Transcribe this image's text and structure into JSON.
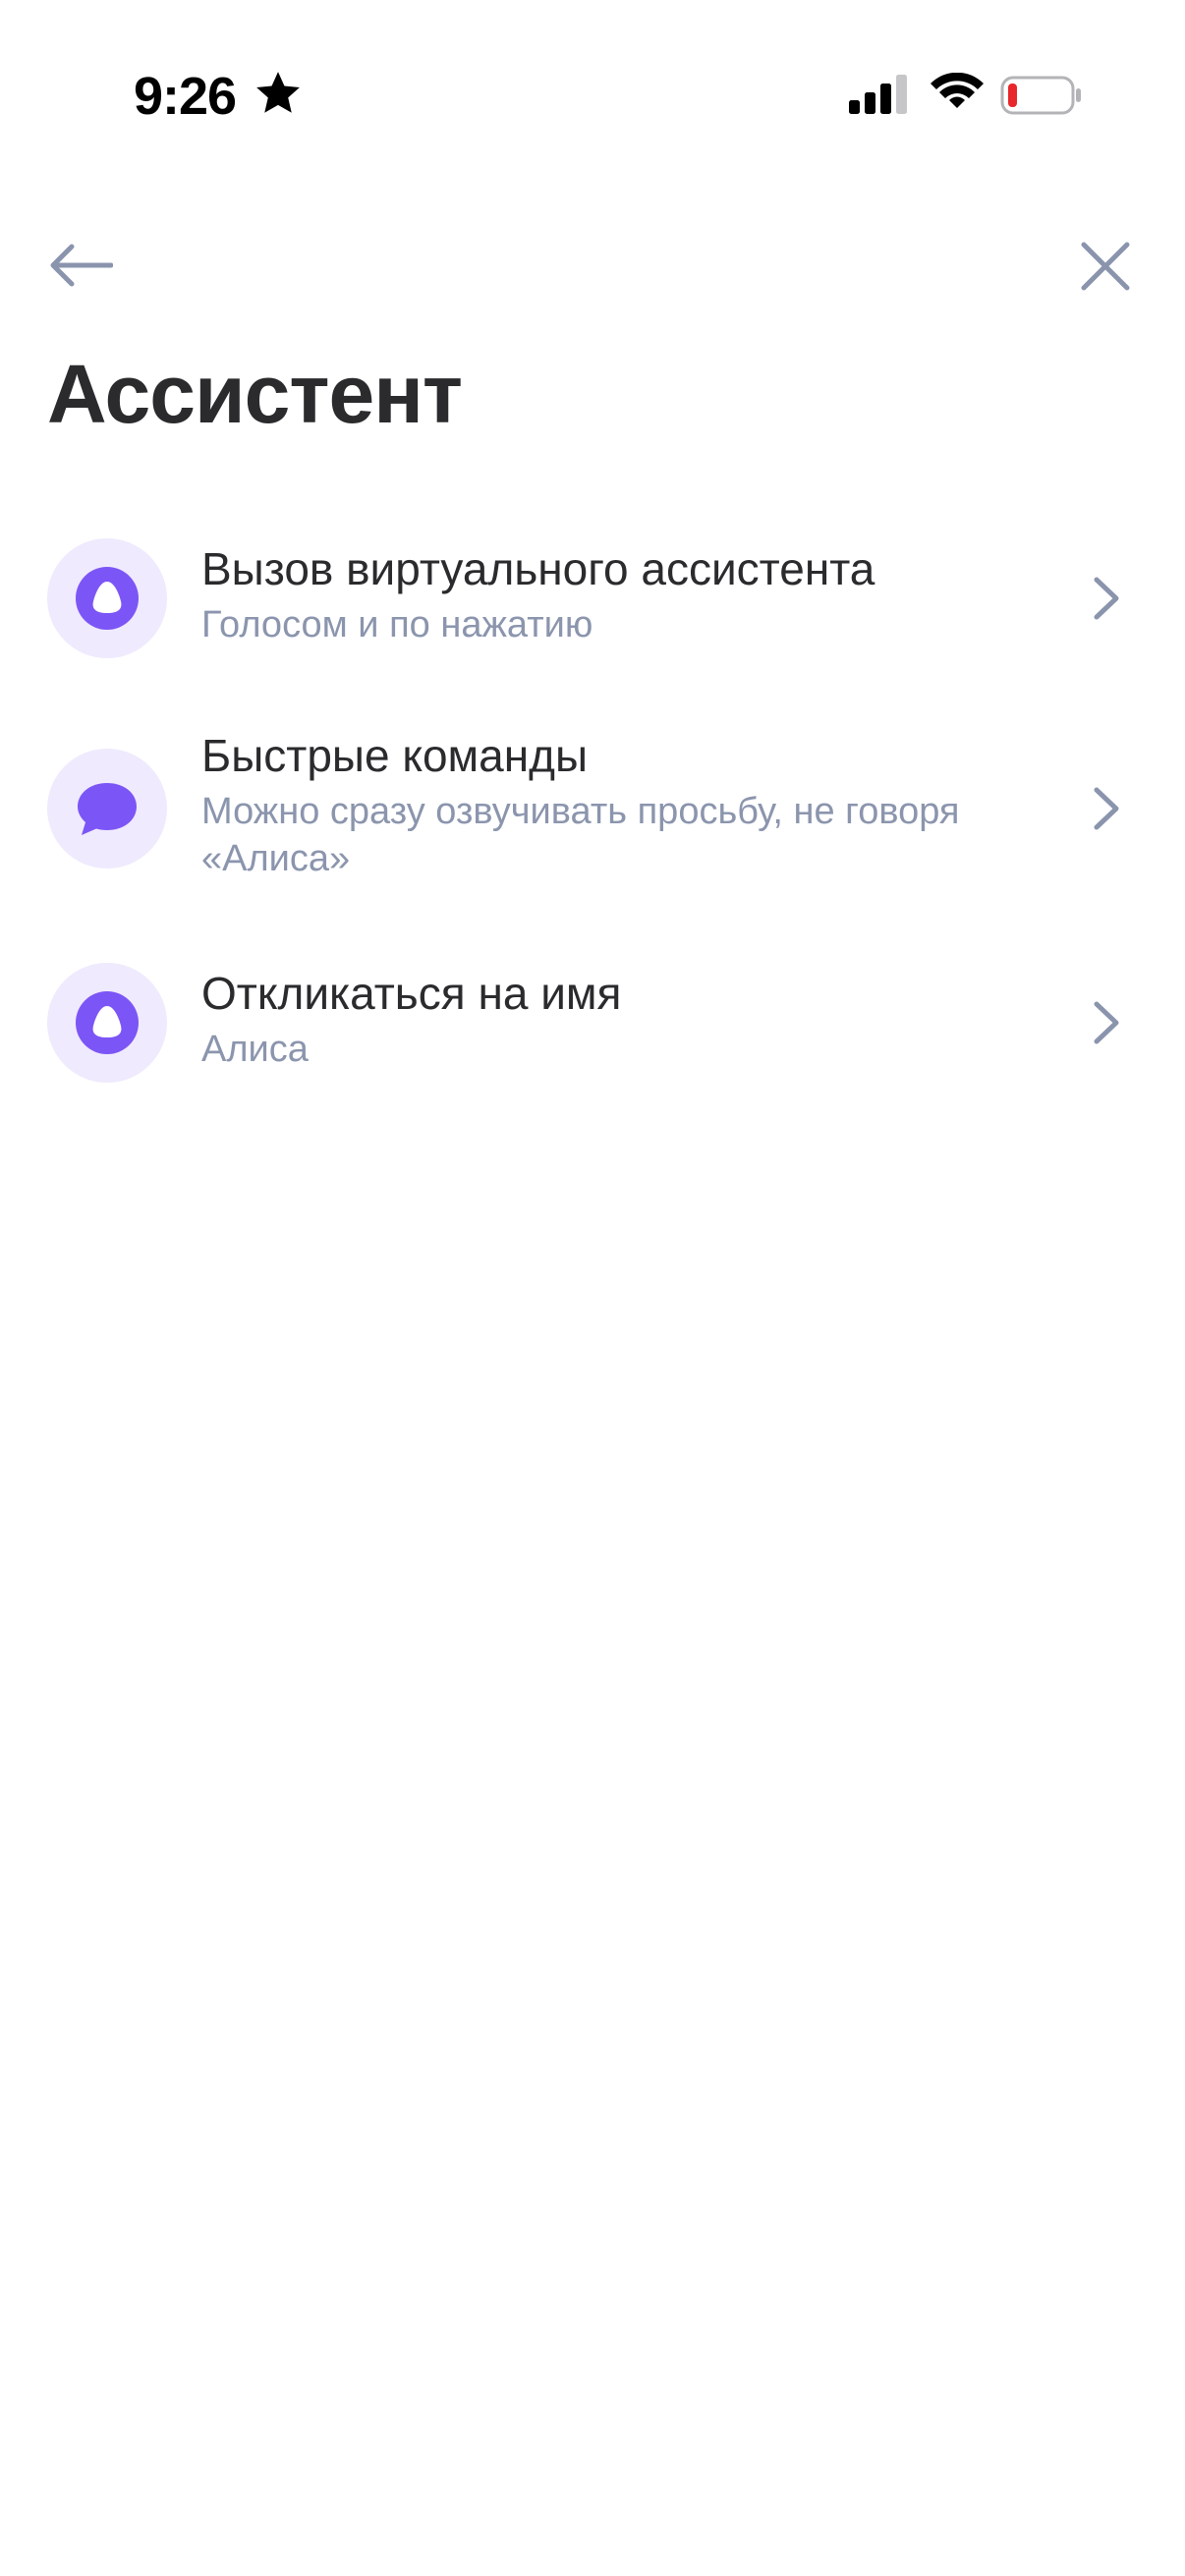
{
  "status_bar": {
    "time": "9:26",
    "icons": [
      "star-icon",
      "cellular-signal-icon",
      "wifi-icon",
      "battery-low-icon"
    ]
  },
  "nav": {
    "back_icon": "arrow-left-icon",
    "close_icon": "close-icon"
  },
  "page": {
    "title": "Ассистент"
  },
  "items": [
    {
      "title": "Вызов виртуального ассистента",
      "subtitle": "Голосом и по нажатию",
      "icon": "alice-icon"
    },
    {
      "title": "Быстрые команды",
      "subtitle": "Можно сразу озвучивать просьбу, не говоря «Алиса»",
      "icon": "speech-bubble-icon"
    },
    {
      "title": "Откликаться на имя",
      "subtitle": "Алиса",
      "icon": "alice-icon"
    }
  ],
  "colors": {
    "accent": "#7c55f6",
    "icon_background": "#efeafd",
    "secondary_text": "#8b95ad",
    "primary_text": "#2b2b2e",
    "battery_low": "#e8262b"
  }
}
